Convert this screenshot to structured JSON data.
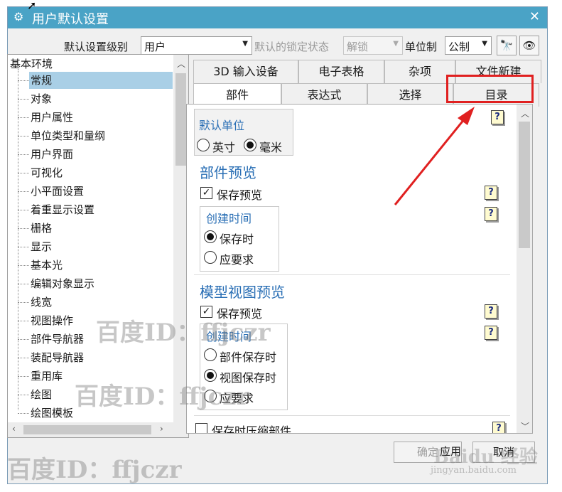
{
  "window": {
    "title": "用户默认设置",
    "title_icon": "gear-icon",
    "close": "✕"
  },
  "toolbar": {
    "level_label": "默认设置级别",
    "level_value": "用户",
    "lock_label": "默认的锁定状态",
    "lock_value": "解锁",
    "unit_label": "单位制",
    "unit_value": "公制"
  },
  "tree": {
    "root": "基本环境",
    "items": [
      "常规",
      "对象",
      "用户属性",
      "单位类型和量纲",
      "用户界面",
      "可视化",
      "小平面设置",
      "着重显示设置",
      "栅格",
      "显示",
      "基本光",
      "编辑对象显示",
      "线宽",
      "视图操作",
      "部件导航器",
      "装配导航器",
      "重用库",
      "绘图",
      "绘图模板"
    ]
  },
  "tabs": {
    "row1": [
      "3D 输入设备",
      "电子表格",
      "杂项",
      "文件新建"
    ],
    "row2": [
      "部件",
      "表达式",
      "选择",
      "目录"
    ]
  },
  "panel": {
    "default_unit": {
      "title": "默认单位",
      "inch": "英寸",
      "mm": "毫米"
    },
    "part_preview": {
      "title": "部件预览",
      "save_preview": "保存预览",
      "create_time": "创建时间",
      "on_save": "保存时",
      "on_demand": "应要求"
    },
    "model_preview": {
      "title": "模型视图预览",
      "save_preview": "保存预览",
      "create_time": "创建时间",
      "part_save": "部件保存时",
      "view_save": "视图保存时",
      "on_demand": "应要求"
    },
    "compress": "保存时压缩部件",
    "help": "?"
  },
  "buttons": {
    "ok": "确定",
    "apply": "应用",
    "cancel": "取消"
  },
  "watermarks": {
    "baidu_id": "百度ID：ffjczr",
    "baidu_logo": "Baidu 经验",
    "url": "jingyan.baidu.com"
  }
}
